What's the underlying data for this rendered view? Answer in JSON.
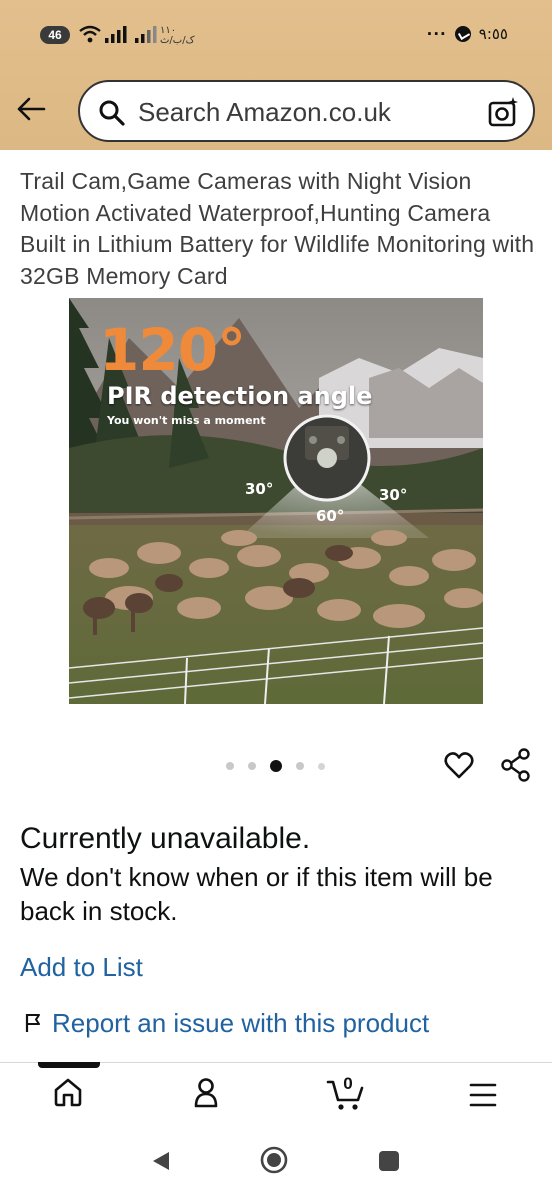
{
  "status_bar": {
    "network_badge": "46",
    "carrier_text": "١١٠\nک/ب/ث",
    "time": "٩:٥٥",
    "overflow": "···"
  },
  "header": {
    "search": {
      "placeholder": "Search Amazon.co.uk",
      "value": ""
    }
  },
  "product": {
    "title": "Trail Cam,Game Cameras with Night Vision Motion Activated Waterproof,Hunting Camera Built in Lithium Battery for Wildlife Monitoring with 32GB Memory Card",
    "image": {
      "headline": "120°",
      "subheadline": "PIR detection angle",
      "tagline": "You won't miss a moment",
      "angle_left": "30°",
      "angle_right": "30°",
      "angle_center": "60°"
    },
    "carousel": {
      "total": 5,
      "active_index": 2
    }
  },
  "availability": {
    "status": "Currently unavailable.",
    "description": "We don't know when or if this item will be back in stock."
  },
  "actions": {
    "add_to_list": "Add to List",
    "report_issue": "Report an issue with this product"
  },
  "bottom_nav": {
    "items": [
      "home",
      "account",
      "cart",
      "menu"
    ],
    "cart_count": "0",
    "active": "home"
  },
  "colors": {
    "header_bg": "#dcb884",
    "link": "#2162a1",
    "headline_orange": "#ee8a3a"
  }
}
